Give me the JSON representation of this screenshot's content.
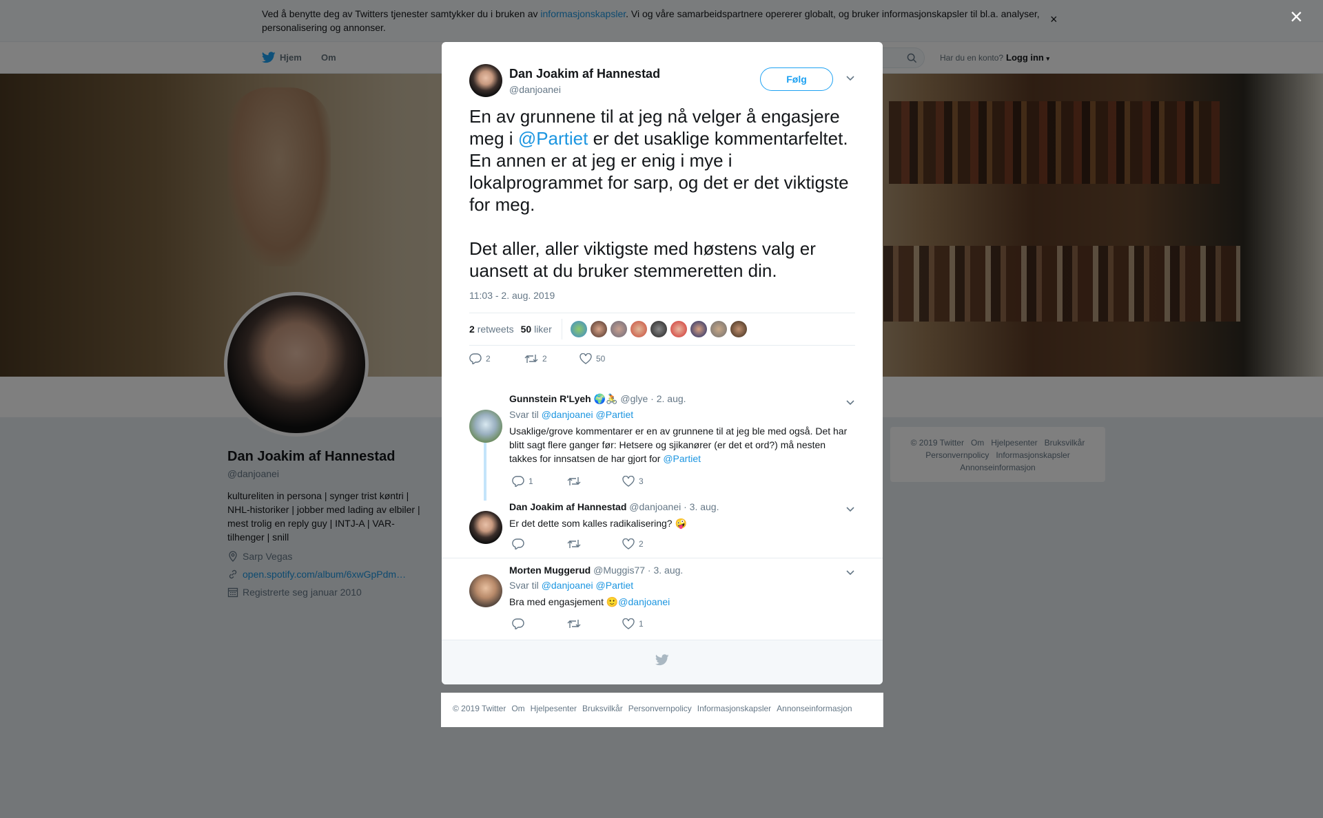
{
  "cookie": {
    "text_before": "Ved å benytte deg av Twitters tjenester samtykker du i bruken av ",
    "link": "informasjonskapsler",
    "text_after": ". Vi og våre samarbeidspartnere opererer globalt, og bruker informasjonskapsler til bl.a. analyser, personalisering og annonser.",
    "close": "×"
  },
  "nav": {
    "home": "Hjem",
    "about": "Om",
    "login_question": "Har du en konto?",
    "login": "Logg inn"
  },
  "profile": {
    "name": "Dan Joakim af Hannestad",
    "handle": "@danjoanei",
    "bio": "kultureliten in persona | synger trist køntri | NHL-historiker | jobber med lading av elbiler | mest trolig en reply guy | INTJ-A | VAR-tilhenger | snill",
    "location": "Sarp Vegas",
    "url": "open.spotify.com/album/6xwGpPdm…",
    "joined": "Registrerte seg januar 2010"
  },
  "side_footer": [
    "© 2019 Twitter",
    "Om",
    "Hjelpesenter",
    "Bruksvilkår",
    "Personvernpolicy",
    "Informasjonskapsler",
    "Annonseinformasjon"
  ],
  "overlay": {
    "close": "×"
  },
  "tweet": {
    "author_name": "Dan Joakim af Hannestad",
    "author_handle": "@danjoanei",
    "follow_label": "Følg",
    "text_p1_a": "En av grunnene til at jeg nå velger å engasjere meg i ",
    "text_p1_mention": "@Partiet",
    "text_p1_b": " er det usaklige kommentarfeltet. En annen er at jeg er enig i mye i lokalprogrammet for sarp, og det er det viktigste for meg.",
    "text_p2": "Det aller, aller viktigste med høstens valg er uansett at du bruker stemmeretten din.",
    "time": "11:03 - 2. aug. 2019",
    "retweets_count": "2",
    "retweets_label": "retweets",
    "likes_count": "50",
    "likes_label": "liker",
    "actions": {
      "replies": "2",
      "retweets": "2",
      "likes": "50"
    }
  },
  "replies": [
    {
      "name": "Gunnstein R'Lyeh",
      "emoji": "🌍🚴",
      "handle": "@glye",
      "date": "· 2. aug.",
      "reply_to_label": "Svar til",
      "reply_to": "@danjoanei @Partiet",
      "body": "Usaklige/grove kommentarer er en av grunnene til at jeg ble med også. Det har blitt sagt flere ganger før: Hetsere og sjikanører (er det et ord?) må nesten takkes for innsatsen de har gjort for ",
      "body_mention": "@Partiet",
      "replies": "1",
      "retweets": "",
      "likes": "3"
    },
    {
      "name": "Dan Joakim af Hannestad",
      "handle": "@danjoanei",
      "date": "· 3. aug.",
      "body": "Er det dette som kalles radikalisering? 🤪",
      "replies": "",
      "retweets": "",
      "likes": "2"
    },
    {
      "name": "Morten Muggerud",
      "handle": "@Muggis77",
      "date": "· 3. aug.",
      "reply_to_label": "Svar til",
      "reply_to": "@danjoanei @Partiet",
      "body": "Bra med engasjement 🙂",
      "body_mention": "@danjoanei",
      "replies": "",
      "retweets": "",
      "likes": "1"
    }
  ],
  "bottom_footer": [
    "© 2019 Twitter",
    "Om",
    "Hjelpesenter",
    "Bruksvilkår",
    "Personvernpolicy",
    "Informasjonskapsler",
    "Annonseinformasjon"
  ],
  "colors": {
    "accent": "#1da1f2",
    "link": "#1b95e0",
    "overlay": "rgba(0,0,0,0.5)"
  }
}
